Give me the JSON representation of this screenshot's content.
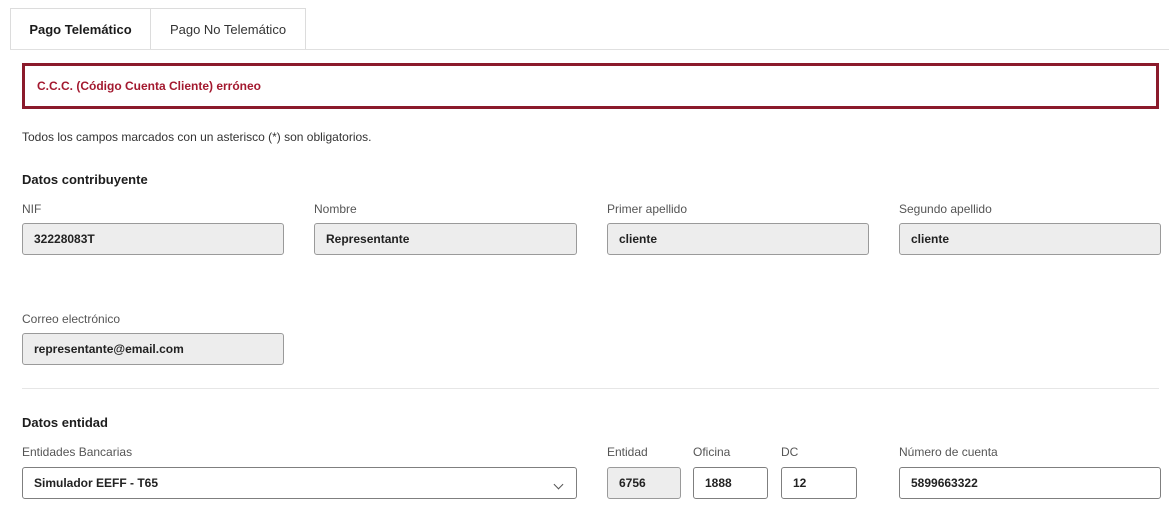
{
  "tabs": [
    {
      "label": "Pago Telemático",
      "active": true
    },
    {
      "label": "Pago No Telemático",
      "active": false
    }
  ],
  "error": {
    "message": "C.C.C. (Código Cuenta Cliente) erróneo",
    "border_color": "#8b1a2b",
    "text_color": "#a3192f"
  },
  "required_note": "Todos los campos marcados con un asterisco (*) son obligatorios.",
  "contribuyente": {
    "title": "Datos contribuyente",
    "nif": {
      "label": "NIF",
      "value": "32228083T"
    },
    "nombre": {
      "label": "Nombre",
      "value": "Representante"
    },
    "primer_apellido": {
      "label": "Primer apellido",
      "value": "cliente"
    },
    "segundo_apellido": {
      "label": "Segundo apellido",
      "value": "cliente"
    },
    "correo": {
      "label": "Correo electrónico",
      "value": "representante@email.com"
    }
  },
  "entidad": {
    "title": "Datos entidad",
    "entidades_bancarias": {
      "label": "Entidades Bancarias",
      "selected": "Simulador EEFF - T65"
    },
    "entidad": {
      "label": "Entidad",
      "value": "6756"
    },
    "oficina": {
      "label": "Oficina",
      "value": "1888"
    },
    "dc": {
      "label": "DC",
      "value": "12"
    },
    "numero_cuenta": {
      "label": "Número de cuenta",
      "value": "5899663322"
    }
  },
  "icons": {
    "select_arrow": "chevron-down-icon"
  }
}
